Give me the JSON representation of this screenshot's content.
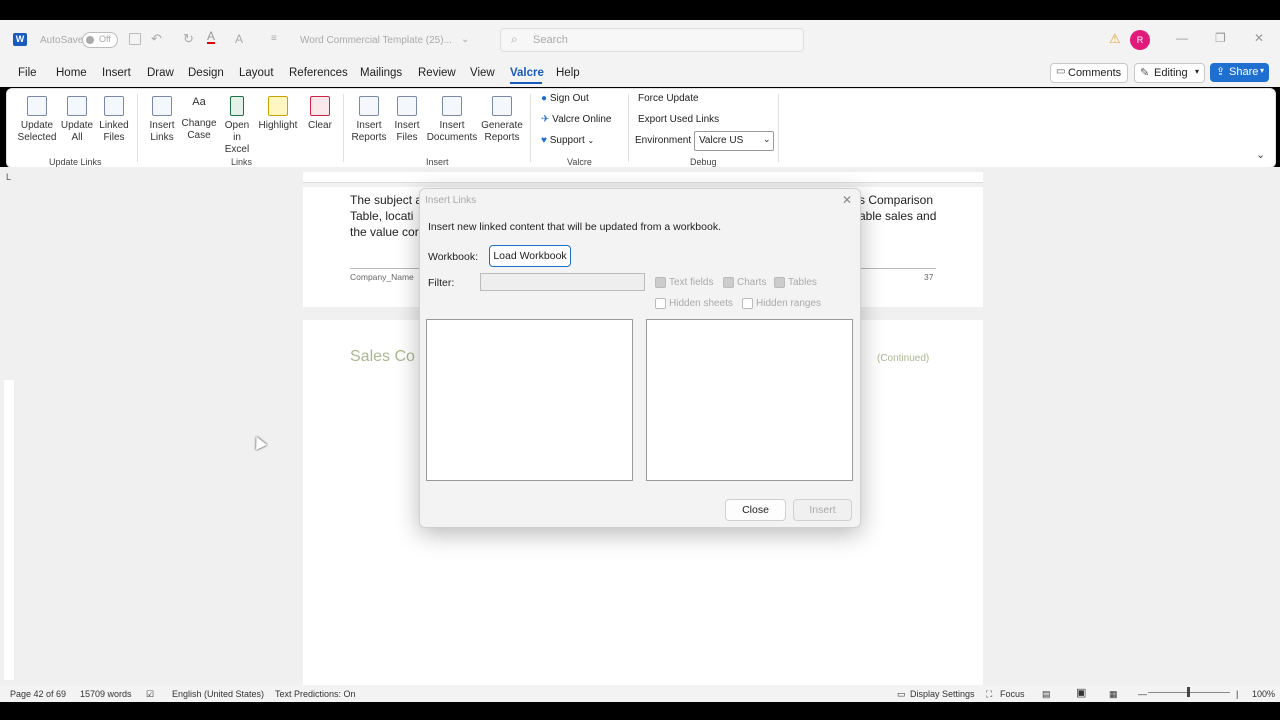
{
  "titlebar": {
    "autosave_label": "AutoSave",
    "autosave_state": "Off",
    "doc_title": "Word Commercial Template (25)...",
    "search_placeholder": "Search",
    "avatar_initial": "R"
  },
  "menu": [
    "File",
    "Home",
    "Insert",
    "Draw",
    "Design",
    "Layout",
    "References",
    "Mailings",
    "Review",
    "View",
    "Valcre",
    "Help"
  ],
  "actions": {
    "comments": "Comments",
    "editing": "Editing",
    "share": "Share"
  },
  "ribbon": {
    "update_links": {
      "group": "Update Links",
      "buttons": [
        "Update Selected",
        "Update All",
        "Linked Files"
      ]
    },
    "links": {
      "group": "Links",
      "buttons": [
        "Insert Links",
        "Change Case",
        "Open in Excel",
        "Highlight",
        "Clear"
      ]
    },
    "insert": {
      "group": "Insert",
      "buttons": [
        "Insert Reports",
        "Insert Files",
        "Insert Documents",
        "Generate Reports"
      ]
    },
    "valcre": {
      "group": "Valcre",
      "items": [
        "Sign Out",
        "Valcre Online",
        "Support"
      ]
    },
    "debug": {
      "group": "Debug",
      "force_update": "Force Update",
      "export_used_links": "Export Used Links",
      "environment_label": "Environment",
      "environment_value": "Valcre US"
    }
  },
  "document": {
    "p1_left_a": "The subject a",
    "p1_left_b": "Table, locati",
    "p1_left_c": "the value cor",
    "p1_right_a": "s Comparison",
    "p1_right_b": "able sales and",
    "footer_left": "Company_Name",
    "footer_page": "37",
    "p2_heading": "Sales Co",
    "p2_continued": "(Continued)"
  },
  "dialog": {
    "title": "Insert Links",
    "description": "Insert new linked content that will be updated from a workbook.",
    "workbook_label": "Workbook:",
    "load_button": "Load Workbook",
    "filter_label": "Filter:",
    "filter_value": "",
    "checkboxes": [
      {
        "label": "Text fields",
        "checked": true
      },
      {
        "label": "Charts",
        "checked": true
      },
      {
        "label": "Tables",
        "checked": true
      },
      {
        "label": "Hidden sheets",
        "checked": false
      },
      {
        "label": "Hidden ranges",
        "checked": false
      }
    ],
    "close_button": "Close",
    "insert_button": "Insert"
  },
  "statusbar": {
    "page": "Page 42 of 69",
    "words": "15709 words",
    "language": "English (United States)",
    "predictions": "Text Predictions: On",
    "display_settings": "Display Settings",
    "focus": "Focus",
    "zoom": "100%"
  },
  "colors": {
    "accent": "#1f6fd1",
    "valcre_underline": "#185abd",
    "heading_green": "#a8b890",
    "avatar": "#e0197a"
  }
}
